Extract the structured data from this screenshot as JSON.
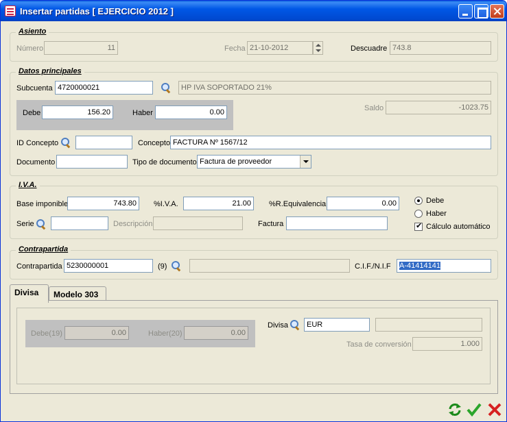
{
  "window": {
    "title": "Insertar partidas [ EJERCICIO 2012 ]"
  },
  "asiento": {
    "legend": "Asiento",
    "numero_label": "Número",
    "numero_value": "11",
    "fecha_label": "Fecha",
    "fecha_value": "21-10-2012",
    "descuadre_label": "Descuadre",
    "descuadre_value": "743.8"
  },
  "datos": {
    "legend": "Datos principales",
    "subcuenta_label": "Subcuenta",
    "subcuenta_value": "4720000021",
    "subcuenta_desc": "HP IVA SOPORTADO 21%",
    "debe_label": "Debe",
    "debe_value": "156.20",
    "haber_label": "Haber",
    "haber_value": "0.00",
    "saldo_label": "Saldo",
    "saldo_value": "-1023.75",
    "idconcepto_label": "ID Concepto",
    "idconcepto_value": "",
    "concepto_label": "Concepto",
    "concepto_value": "FACTURA Nº 1567/12",
    "documento_label": "Documento",
    "documento_value": "",
    "tipodoc_label": "Tipo de documento",
    "tipodoc_value": "Factura de proveedor"
  },
  "iva": {
    "legend": "I.V.A.",
    "base_label": "Base imponible",
    "base_value": "743.80",
    "piva_label": "%I.V.A.",
    "piva_value": "21.00",
    "preq_label": "%R.Equivalencia",
    "preq_value": "0.00",
    "serie_label": "Serie",
    "serie_value": "",
    "descripcion_label": "Descripción",
    "descripcion_value": "",
    "factura_label": "Factura",
    "factura_value": "",
    "debe_radio": "Debe",
    "haber_radio": "Haber",
    "calculo_label": "Cálculo automático"
  },
  "contrapartida": {
    "legend": "Contrapartida",
    "label": "Contrapartida",
    "value": "5230000001",
    "count": "(9)",
    "desc": "",
    "cif_label": "C.I.F./N.I.F",
    "cif_value": "A-41414141"
  },
  "tabs": [
    {
      "label": "Divisa"
    },
    {
      "label": "Modelo 303"
    }
  ],
  "divisa": {
    "debe_label": "Debe(19)",
    "debe_value": "0.00",
    "haber_label": "Haber(20)",
    "haber_value": "0.00",
    "divisa_label": "Divisa",
    "divisa_value": "EUR",
    "divisa_desc": "",
    "tasa_label": "Tasa de conversión",
    "tasa_value": "1.000"
  }
}
